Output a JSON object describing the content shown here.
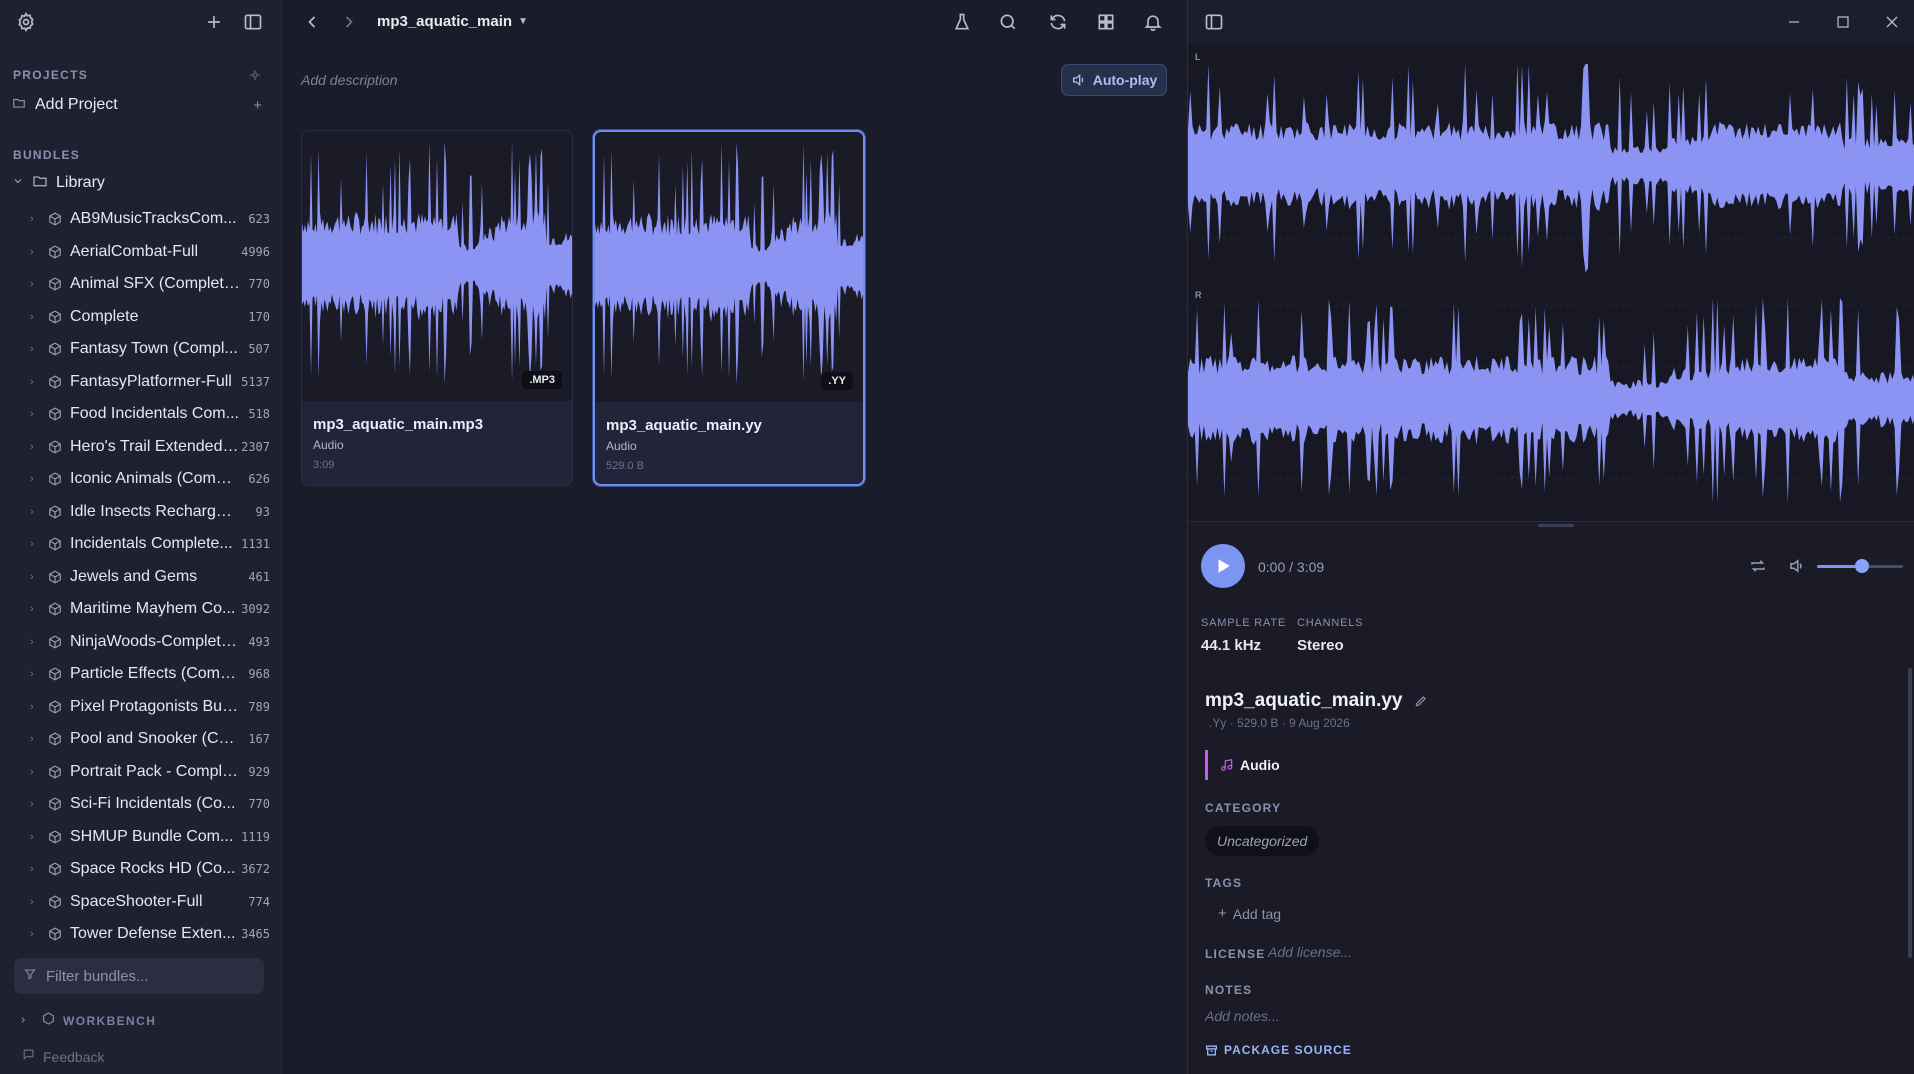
{
  "sidebar": {
    "projects_header": "PROJECTS",
    "add_project_label": "Add Project",
    "bundles_header": "BUNDLES",
    "library_label": "Library",
    "bundles": [
      {
        "name": "AB9MusicTracksCom...",
        "count": "623"
      },
      {
        "name": "AerialCombat-Full",
        "count": "4996"
      },
      {
        "name": "Animal SFX (Complete...",
        "count": "770"
      },
      {
        "name": "Complete",
        "count": "170"
      },
      {
        "name": "Fantasy Town (Compl...",
        "count": "507"
      },
      {
        "name": "FantasyPlatformer-Full",
        "count": "5137"
      },
      {
        "name": "Food Incidentals Com...",
        "count": "518"
      },
      {
        "name": "Hero's Trail Extended ...",
        "count": "2307"
      },
      {
        "name": "Iconic Animals (Compl...",
        "count": "626"
      },
      {
        "name": "Idle Insects Recharged ...",
        "count": "93"
      },
      {
        "name": "Incidentals Complete...",
        "count": "1131"
      },
      {
        "name": "Jewels and Gems",
        "count": "461"
      },
      {
        "name": "Maritime Mayhem Co...",
        "count": "3092"
      },
      {
        "name": "NinjaWoods-Complete...",
        "count": "493"
      },
      {
        "name": "Particle Effects (Comp...",
        "count": "968"
      },
      {
        "name": "Pixel Protagonists Bun...",
        "count": "789"
      },
      {
        "name": "Pool and Snooker (Co...",
        "count": "167"
      },
      {
        "name": "Portrait Pack - Comple...",
        "count": "929"
      },
      {
        "name": "Sci-Fi Incidentals (Co...",
        "count": "770"
      },
      {
        "name": "SHMUP Bundle Com...",
        "count": "1119"
      },
      {
        "name": "Space Rocks HD (Co...",
        "count": "3672"
      },
      {
        "name": "SpaceShooter-Full",
        "count": "774"
      },
      {
        "name": "Tower Defense Exten...",
        "count": "3465"
      }
    ],
    "filter_placeholder": "Filter bundles...",
    "workbench_label": "WORKBENCH",
    "feedback_label": "Feedback"
  },
  "main": {
    "breadcrumb": "mp3_aquatic_main",
    "description_placeholder": "Add description",
    "autoplay_label": "Auto-play",
    "cards": [
      {
        "badge": ".MP3",
        "name": "mp3_aquatic_main.mp3",
        "type": "Audio",
        "meta": "3:09",
        "selected": false
      },
      {
        "badge": ".YY",
        "name": "mp3_aquatic_main.yy",
        "type": "Audio",
        "meta": "529.0 B",
        "selected": true
      }
    ]
  },
  "detail": {
    "channel_left": "L",
    "channel_right": "R",
    "time": "0:00 / 3:09",
    "volume_level": 0.52,
    "sample_rate_label": "SAMPLE RATE",
    "sample_rate_value": "44.1 kHz",
    "channels_label": "CHANNELS",
    "channels_value": "Stereo",
    "file_title": "mp3_aquatic_main.yy",
    "file_subline": ".Yy · 529.0 B · 9 Aug 2026",
    "type_label": "Audio",
    "category_label": "CATEGORY",
    "category_value": "Uncategorized",
    "tags_label": "TAGS",
    "add_tag_label": "Add tag",
    "license_label": "LICENSE",
    "license_placeholder": "Add license...",
    "notes_label": "NOTES",
    "notes_placeholder": "Add notes...",
    "package_source_label": "PACKAGE SOURCE"
  },
  "colors": {
    "accent": "#7d95f2",
    "waveform": "#8b93f3",
    "audio_type": "#c75cf5"
  }
}
